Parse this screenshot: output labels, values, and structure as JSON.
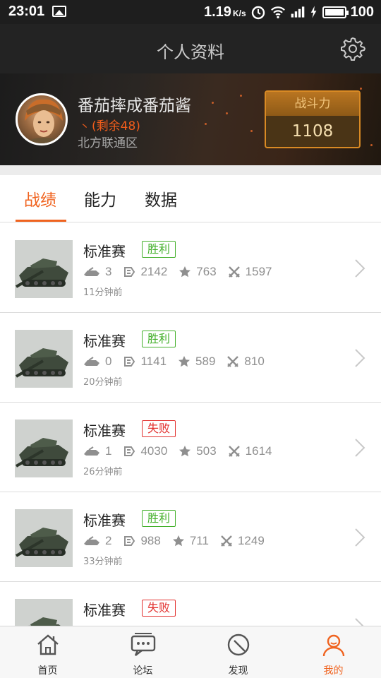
{
  "status_bar": {
    "time": "23:01",
    "speed": "1.19",
    "speed_unit": "K/s",
    "battery": "100"
  },
  "header": {
    "title": "个人资料"
  },
  "profile": {
    "name": "番茄摔成番茄酱",
    "remaining": "(剩余48)",
    "region": "北方联通区",
    "power_label": "战斗力",
    "power_value": "1108"
  },
  "tabs": [
    {
      "label": "战绩",
      "active": true
    },
    {
      "label": "能力",
      "active": false
    },
    {
      "label": "数据",
      "active": false
    }
  ],
  "battles": [
    {
      "mode": "标准赛",
      "result": "胜利",
      "outcome": "win",
      "kills": "3",
      "damage": "2142",
      "exp": "763",
      "assist": "1597",
      "time": "11分钟前"
    },
    {
      "mode": "标准赛",
      "result": "胜利",
      "outcome": "win",
      "kills": "0",
      "damage": "1141",
      "exp": "589",
      "assist": "810",
      "time": "20分钟前"
    },
    {
      "mode": "标准赛",
      "result": "失败",
      "outcome": "lose",
      "kills": "1",
      "damage": "4030",
      "exp": "503",
      "assist": "1614",
      "time": "26分钟前"
    },
    {
      "mode": "标准赛",
      "result": "胜利",
      "outcome": "win",
      "kills": "2",
      "damage": "988",
      "exp": "711",
      "assist": "1249",
      "time": "33分钟前"
    },
    {
      "mode": "标准赛",
      "result": "失败",
      "outcome": "lose",
      "kills": "",
      "damage": "",
      "exp": "",
      "assist": "",
      "time": ""
    }
  ],
  "bottom_nav": [
    {
      "label": "首页",
      "icon": "home-icon",
      "active": false
    },
    {
      "label": "论坛",
      "icon": "forum-icon",
      "active": false
    },
    {
      "label": "发现",
      "icon": "discover-icon",
      "active": false
    },
    {
      "label": "我的",
      "icon": "profile-icon",
      "active": true
    }
  ],
  "colors": {
    "accent": "#f0631f",
    "win": "#43b02a",
    "lose": "#e2302e",
    "power_border": "#d98a24"
  }
}
